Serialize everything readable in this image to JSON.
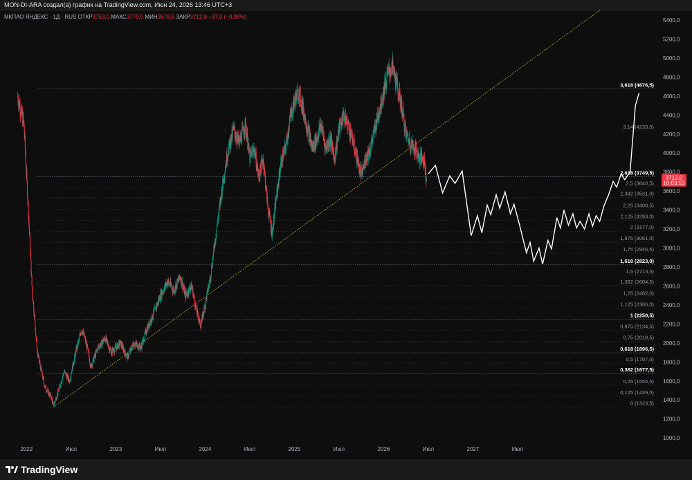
{
  "header": {
    "text": "MON-DI-ARA создал(а) график на TradingView.com, Июн 24, 2026 13:46 UTC+3"
  },
  "symbol": {
    "name": "МКПАО ЯНДЕКС · 1Д · RUS",
    "open_label": "ОТКР",
    "open_value": "3753,0",
    "high_label": "МАКС",
    "high_value": "3779,0",
    "low_label": "МИН",
    "low_value": "3678,5",
    "close_label": "ЗАКР",
    "close_value": "3712,0 −37,0 (−0,99%)"
  },
  "price_tag": {
    "price": "3712,0",
    "countdown": "10:03:53",
    "color": "#f23645"
  },
  "footer": {
    "logo_text": "TradingView"
  },
  "colors": {
    "background": "#0e0e0e",
    "up_candle": "#089981",
    "down_candle": "#f23645",
    "fib_line": "#787b86",
    "trendline": "#c9c34a",
    "projection": "#ffffff"
  },
  "chart_data": {
    "type": "candlestick",
    "y_ticks": [
      1000,
      1200,
      1400,
      1600,
      1800,
      2000,
      2200,
      2400,
      2600,
      2800,
      3000,
      3200,
      3400,
      3600,
      3800,
      4000,
      4200,
      4400,
      4600,
      4800,
      5000,
      5200,
      5400
    ],
    "y_tick_labels": [
      "1000,0",
      "1200,0",
      "1400,0",
      "1600,0",
      "1800,0",
      "2000,0",
      "2200,0",
      "2400,0",
      "2600,0",
      "2800,0",
      "3000,0",
      "3200,0",
      "3400,0",
      "3600,0",
      "3800,0",
      "4000,0",
      "4200,0",
      "4400,0",
      "4600,0",
      "4800,0",
      "5000,0",
      "5200,0",
      "5400,0"
    ],
    "ylim": [
      950,
      5480
    ],
    "x_ticks": [
      {
        "label": "2022",
        "t": 2022.0
      },
      {
        "label": "Июл",
        "t": 2022.5
      },
      {
        "label": "2023",
        "t": 2023.0
      },
      {
        "label": "Июл",
        "t": 2023.5
      },
      {
        "label": "2024",
        "t": 2024.0
      },
      {
        "label": "Июл",
        "t": 2024.5
      },
      {
        "label": "2025",
        "t": 2025.0
      },
      {
        "label": "Июл",
        "t": 2025.5
      },
      {
        "label": "2026",
        "t": 2026.0
      },
      {
        "label": "Июл",
        "t": 2026.5
      },
      {
        "label": "2027",
        "t": 2027.0
      },
      {
        "label": "Июл",
        "t": 2027.5
      }
    ],
    "fib_levels": [
      {
        "label": "0 (1323,5)",
        "value": 1323.5,
        "bold": false
      },
      {
        "label": "0,125 (1439,5)",
        "value": 1439.5,
        "bold": false
      },
      {
        "label": "0,25 (1555,5)",
        "value": 1555.5,
        "bold": false
      },
      {
        "label": "0,382 (1677,5)",
        "value": 1677.5,
        "bold": true
      },
      {
        "label": "0,5 (1787,0)",
        "value": 1787.0,
        "bold": false
      },
      {
        "label": "0,618 (1896,5)",
        "value": 1896.5,
        "bold": true
      },
      {
        "label": "0,75 (2018,5)",
        "value": 2018.5,
        "bold": false
      },
      {
        "label": "0,875 (2134,5)",
        "value": 2134.5,
        "bold": false
      },
      {
        "label": "1 (2250,5)",
        "value": 2250.5,
        "bold": true
      },
      {
        "label": "1,125 (2366,0)",
        "value": 2366.0,
        "bold": false
      },
      {
        "label": "1,25 (2482,0)",
        "value": 2482.0,
        "bold": false
      },
      {
        "label": "1,382 (2604,5)",
        "value": 2604.5,
        "bold": false
      },
      {
        "label": "1,5 (2713,5)",
        "value": 2713.5,
        "bold": false
      },
      {
        "label": "1,618 (2823,0)",
        "value": 2823.0,
        "bold": true
      },
      {
        "label": "1,75 (2945,5)",
        "value": 2945.5,
        "bold": false
      },
      {
        "label": "1,875 (3061,0)",
        "value": 3061.0,
        "bold": false
      },
      {
        "label": "2 (3177,0)",
        "value": 3177.0,
        "bold": false
      },
      {
        "label": "2,125 (3293,0)",
        "value": 3293.0,
        "bold": false
      },
      {
        "label": "2,25 (3408,5)",
        "value": 3408.5,
        "bold": false
      },
      {
        "label": "2,382 (3531,0)",
        "value": 3531.0,
        "bold": false
      },
      {
        "label": "2,5 (3640,5)",
        "value": 3640.5,
        "bold": false
      },
      {
        "label": "2,618 (3749,5)",
        "value": 3749.5,
        "bold": true
      },
      {
        "label": "3,14 (4233,5)",
        "value": 4233.5,
        "bold": false
      },
      {
        "label": "3,618 (4676,5)",
        "value": 4676.5,
        "bold": true
      }
    ],
    "trendline": {
      "from": [
        2022.3,
        1323.5
      ],
      "to": [
        2027.9,
        5400
      ]
    },
    "price_path": [
      [
        2021.8,
        5400
      ],
      [
        2021.9,
        4600
      ],
      [
        2021.97,
        4300
      ],
      [
        2022.03,
        3200
      ],
      [
        2022.06,
        2600
      ],
      [
        2022.12,
        1900
      ],
      [
        2022.2,
        1550
      ],
      [
        2022.28,
        1420
      ],
      [
        2022.3,
        1340
      ],
      [
        2022.36,
        1500
      ],
      [
        2022.42,
        1700
      ],
      [
        2022.48,
        1600
      ],
      [
        2022.55,
        1900
      ],
      [
        2022.62,
        2150
      ],
      [
        2022.68,
        1950
      ],
      [
        2022.72,
        1750
      ],
      [
        2022.8,
        1950
      ],
      [
        2022.88,
        2050
      ],
      [
        2022.95,
        1900
      ],
      [
        2023.05,
        2000
      ],
      [
        2023.13,
        1850
      ],
      [
        2023.2,
        2000
      ],
      [
        2023.28,
        1950
      ],
      [
        2023.35,
        2150
      ],
      [
        2023.42,
        2300
      ],
      [
        2023.5,
        2500
      ],
      [
        2023.58,
        2650
      ],
      [
        2023.65,
        2550
      ],
      [
        2023.72,
        2700
      ],
      [
        2023.78,
        2500
      ],
      [
        2023.85,
        2600
      ],
      [
        2023.9,
        2350
      ],
      [
        2023.95,
        2180
      ],
      [
        2024.02,
        2500
      ],
      [
        2024.06,
        2700
      ],
      [
        2024.1,
        3000
      ],
      [
        2024.15,
        3350
      ],
      [
        2024.2,
        3700
      ],
      [
        2024.25,
        4000
      ],
      [
        2024.32,
        4250
      ],
      [
        2024.38,
        4100
      ],
      [
        2024.45,
        4300
      ],
      [
        2024.5,
        3950
      ],
      [
        2024.55,
        4050
      ],
      [
        2024.6,
        3750
      ],
      [
        2024.65,
        3950
      ],
      [
        2024.7,
        3450
      ],
      [
        2024.75,
        3150
      ],
      [
        2024.8,
        3550
      ],
      [
        2024.85,
        3900
      ],
      [
        2024.9,
        4050
      ],
      [
        2024.95,
        4350
      ],
      [
        2025.0,
        4550
      ],
      [
        2025.05,
        4650
      ],
      [
        2025.1,
        4450
      ],
      [
        2025.15,
        4250
      ],
      [
        2025.2,
        4050
      ],
      [
        2025.25,
        4150
      ],
      [
        2025.3,
        4300
      ],
      [
        2025.35,
        4050
      ],
      [
        2025.4,
        4150
      ],
      [
        2025.45,
        3950
      ],
      [
        2025.5,
        4250
      ],
      [
        2025.55,
        4400
      ],
      [
        2025.6,
        4300
      ],
      [
        2025.65,
        4150
      ],
      [
        2025.7,
        3950
      ],
      [
        2025.75,
        3750
      ],
      [
        2025.8,
        3950
      ],
      [
        2025.85,
        4050
      ],
      [
        2025.9,
        4250
      ],
      [
        2025.95,
        4450
      ],
      [
        2026.0,
        4650
      ],
      [
        2026.05,
        4850
      ],
      [
        2026.1,
        4900
      ],
      [
        2026.15,
        4700
      ],
      [
        2026.2,
        4500
      ],
      [
        2026.25,
        4200
      ],
      [
        2026.3,
        4100
      ],
      [
        2026.35,
        4050
      ],
      [
        2026.4,
        3950
      ],
      [
        2026.45,
        3950
      ],
      [
        2026.48,
        3712
      ]
    ],
    "projection": [
      [
        2026.5,
        3780
      ],
      [
        2026.58,
        3870
      ],
      [
        2026.66,
        3580
      ],
      [
        2026.74,
        3760
      ],
      [
        2026.8,
        3680
      ],
      [
        2026.88,
        3810
      ],
      [
        2026.98,
        3130
      ],
      [
        2027.05,
        3340
      ],
      [
        2027.1,
        3160
      ],
      [
        2027.16,
        3450
      ],
      [
        2027.2,
        3350
      ],
      [
        2027.26,
        3560
      ],
      [
        2027.3,
        3420
      ],
      [
        2027.36,
        3590
      ],
      [
        2027.42,
        3360
      ],
      [
        2027.46,
        3460
      ],
      [
        2027.52,
        3250
      ],
      [
        2027.6,
        2950
      ],
      [
        2027.64,
        3060
      ],
      [
        2027.68,
        2860
      ],
      [
        2027.74,
        3000
      ],
      [
        2027.78,
        2830
      ],
      [
        2027.84,
        3080
      ],
      [
        2027.88,
        2990
      ],
      [
        2027.94,
        3320
      ],
      [
        2027.98,
        3210
      ],
      [
        2028.02,
        3400
      ],
      [
        2028.07,
        3240
      ],
      [
        2028.12,
        3360
      ],
      [
        2028.16,
        3210
      ],
      [
        2028.2,
        3280
      ],
      [
        2028.25,
        3200
      ],
      [
        2028.3,
        3360
      ],
      [
        2028.34,
        3230
      ],
      [
        2028.38,
        3340
      ],
      [
        2028.42,
        3280
      ],
      [
        2028.47,
        3450
      ],
      [
        2028.52,
        3560
      ],
      [
        2028.57,
        3700
      ],
      [
        2028.61,
        3640
      ],
      [
        2028.66,
        3780
      ],
      [
        2028.7,
        3720
      ],
      [
        2028.76,
        3800
      ],
      [
        2028.82,
        4500
      ],
      [
        2028.86,
        4630
      ]
    ]
  }
}
